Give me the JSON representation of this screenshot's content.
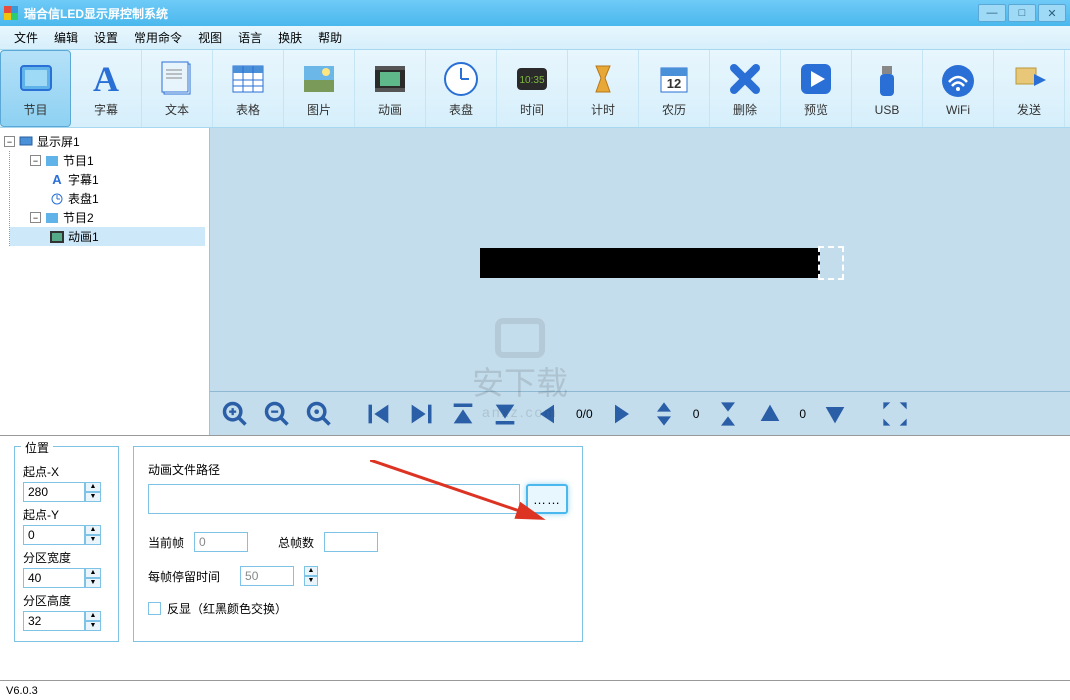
{
  "window": {
    "title": "瑞合信LED显示屏控制系统"
  },
  "menu": [
    "文件",
    "编辑",
    "设置",
    "常用命令",
    "视图",
    "语言",
    "换肤",
    "帮助"
  ],
  "toolbar": [
    {
      "label": "节目",
      "icon": "program",
      "selected": true
    },
    {
      "label": "字幕",
      "icon": "subtitle"
    },
    {
      "label": "文本",
      "icon": "text"
    },
    {
      "label": "表格",
      "icon": "table"
    },
    {
      "label": "图片",
      "icon": "image"
    },
    {
      "label": "动画",
      "icon": "animation"
    },
    {
      "label": "表盘",
      "icon": "clock"
    },
    {
      "label": "时间",
      "icon": "time"
    },
    {
      "label": "计时",
      "icon": "timer"
    },
    {
      "label": "农历",
      "icon": "calendar"
    },
    {
      "label": "删除",
      "icon": "delete"
    },
    {
      "label": "预览",
      "icon": "preview"
    },
    {
      "label": "USB",
      "icon": "usb"
    },
    {
      "label": "WiFi",
      "icon": "wifi"
    },
    {
      "label": "发送",
      "icon": "send"
    }
  ],
  "tree": {
    "root": "显示屏1",
    "items": [
      {
        "label": "节目1",
        "children": [
          "字幕1",
          "表盘1"
        ]
      },
      {
        "label": "节目2",
        "children": [
          "动画1"
        ],
        "selected_child": "动画1"
      }
    ]
  },
  "ctrlbar": {
    "frames": "0/0",
    "h": "0",
    "v": "0"
  },
  "position": {
    "title": "位置",
    "x_label": "起点-X",
    "x_val": "280",
    "y_label": "起点-Y",
    "y_val": "0",
    "w_label": "分区宽度",
    "w_val": "40",
    "h_label": "分区高度",
    "h_val": "32"
  },
  "anim": {
    "path_label": "动画文件路径",
    "path_val": "",
    "browse": "……",
    "cur_frame_label": "当前帧",
    "cur_frame_val": "0",
    "total_frame_label": "总帧数",
    "total_frame_val": "",
    "stay_label": "每帧停留时间",
    "stay_val": "50",
    "invert_label": "反显（红黑颜色交换）"
  },
  "watermark": {
    "text": "安下载",
    "url": "anxz.com"
  },
  "status": {
    "version": "V6.0.3"
  }
}
